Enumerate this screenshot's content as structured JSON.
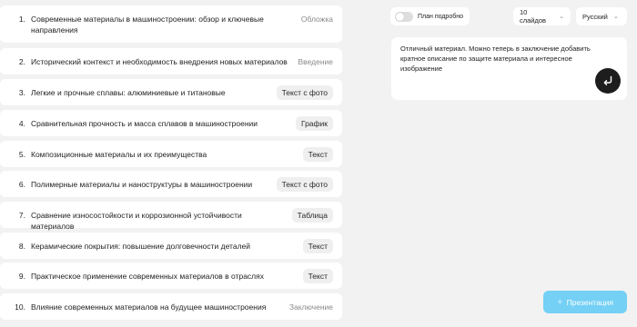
{
  "slides": [
    {
      "number": "1.",
      "title": "Современные материалы в машиностроении: обзор и ключевые направления",
      "type": "Обложка"
    },
    {
      "number": "2.",
      "title": "Исторический контекст и необходимость внедрения новых материалов",
      "type": "Введение"
    },
    {
      "number": "3.",
      "title": "Легкие и прочные сплавы: алюминиевые и титановые",
      "type": "Текст с фото"
    },
    {
      "number": "4.",
      "title": "Сравнительная прочность и масса сплавов в машиностроении",
      "type": "График"
    },
    {
      "number": "5.",
      "title": "Композиционные материалы и их преимущества",
      "type": "Текст"
    },
    {
      "number": "6.",
      "title": "Полимерные материалы и наноструктуры в машиностроении",
      "type": "Текст с фото"
    },
    {
      "number": "7.",
      "title": "Сравнение износостойкости и коррозионной устойчивости материалов",
      "type": "Таблица"
    },
    {
      "number": "8.",
      "title": "Керамические покрытия: повышение долговечности деталей",
      "type": "Текст"
    },
    {
      "number": "9.",
      "title": "Практическое применение современных материалов в отраслях",
      "type": "Текст"
    },
    {
      "number": "10.",
      "title": "Влияние современных материалов на будущее машиностроения",
      "type": "Заключение"
    }
  ],
  "controls": {
    "detailed_plan_label": "План подробно",
    "detailed_plan_on": false,
    "slides_count": "10 слайдов",
    "language": "Русский"
  },
  "prompt": {
    "text": "Отличный материал. Можно теперь в заключение добавить кратное описание по защите материала и интересное изображение"
  },
  "actions": {
    "generate_label": "Презентация"
  },
  "icons": {
    "send": "return-arrow-icon",
    "generate": "sparkle-icon",
    "dropdown": "chevron-down-icon"
  },
  "colors": {
    "background": "#f2f2f2",
    "card": "#ffffff",
    "chip": "#efefef",
    "accent": "#74d0f5",
    "send_button": "#1d1d1d"
  }
}
